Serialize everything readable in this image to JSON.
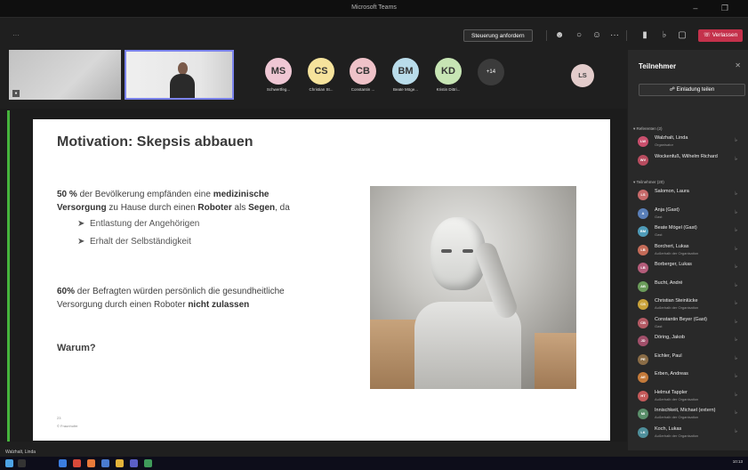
{
  "window": {
    "title": "Microsoft Teams",
    "controls": "–   ❐"
  },
  "toolbar": {
    "back_icon": "ellipsis-icon",
    "control_label": "Steuerung anfordern",
    "leave_label": "Verlassen",
    "more_label": "···"
  },
  "participants_strip": [
    {
      "initials": "MS",
      "name": "Schwertfeg...",
      "color": "#efc7d4"
    },
    {
      "initials": "CS",
      "name": "Christian St...",
      "color": "#f6e39c"
    },
    {
      "initials": "CB",
      "name": "Constantin ...",
      "color": "#efc2c8"
    },
    {
      "initials": "BM",
      "name": "Beate Möge...",
      "color": "#b9dcea"
    },
    {
      "initials": "KD",
      "name": "Kristin Dittri...",
      "color": "#c7e5b4"
    }
  ],
  "more_count": "+14",
  "self_initials": "LS",
  "slide": {
    "heading": "Motivation: Skepsis abbauen",
    "para1_a": "50 %",
    "para1_b": " der Bevölkerung empfänden eine ",
    "para1_c": "medizinische",
    "para1_d": "Versorgung",
    "para1_e": " zu Hause durch einen ",
    "para1_f": "Roboter",
    "para1_g": " als ",
    "para1_h": "Segen",
    "para1_i": ", da",
    "bullet1": "Entlastung der Angehörigen",
    "bullet2": "Erhalt der Selbständigkeit",
    "para2_a": "60%",
    "para2_b": " der Befragten würden persönlich die gesundheitliche",
    "para2_c": "Versorgung durch einen Roboter ",
    "para2_d": "nicht zulassen",
    "question": "Warum?",
    "page_no": "23",
    "footer": "© Fraunhofer"
  },
  "panel": {
    "title": "Teilnehmer",
    "invite_label": "Einladung teilen",
    "presenters_label": "Referenten (2)",
    "attendees_label": "Teilnehmer (20)",
    "presenters": [
      {
        "initials": "LW",
        "name": "Walzhalt, Linda",
        "sub": "Organisator",
        "color": "#c94f6d"
      },
      {
        "initials": "WV",
        "name": "Wockenfuß, Wilhelm Richard",
        "sub": "",
        "color": "#b84c5f"
      }
    ],
    "attendees": [
      {
        "initials": "LS",
        "name": "Salomon, Laura",
        "sub": "",
        "color": "#c76a6a"
      },
      {
        "initials": "A",
        "name": "Anja (Gast)",
        "sub": "Gast",
        "color": "#5a7fb8"
      },
      {
        "initials": "BM",
        "name": "Beate Mögel (Gast)",
        "sub": "Gast",
        "color": "#4f9bb8"
      },
      {
        "initials": "LB",
        "name": "Borchert, Lukas",
        "sub": "Außerhalb der Organisation",
        "color": "#c46b58"
      },
      {
        "initials": "LB",
        "name": "Borberger, Lukas",
        "sub": "",
        "color": "#b45c7a"
      },
      {
        "initials": "AB",
        "name": "Bucht, André",
        "sub": "",
        "color": "#6a9b5a"
      },
      {
        "initials": "CS",
        "name": "Christian Steinlücke",
        "sub": "Außerhalb der Organisation",
        "color": "#c9a23a"
      },
      {
        "initials": "CB",
        "name": "Constantin Beyer (Gast)",
        "sub": "Gast",
        "color": "#b45a64"
      },
      {
        "initials": "JD",
        "name": "Döring, Jakob",
        "sub": "",
        "color": "#a14f6a"
      },
      {
        "initials": "PE",
        "name": "Eichler, Paul",
        "sub": "",
        "color": "#8a6c46"
      },
      {
        "initials": "AE",
        "name": "Erben, Andreas",
        "sub": "",
        "color": "#c47a3a"
      },
      {
        "initials": "HT",
        "name": "Helmut Tappler",
        "sub": "Außerhalb der Organisation",
        "color": "#c45a5a"
      },
      {
        "initials": "MI",
        "name": "Innischkeit, Michael (extern)",
        "sub": "Außerhalb der Organisation",
        "color": "#5a8e6a"
      },
      {
        "initials": "LK",
        "name": "Koch, Lukas",
        "sub": "Außerhalb der Organisation",
        "color": "#4f8f9b"
      }
    ]
  },
  "status_name": "Walzhalt, Linda",
  "clock": "10:13"
}
